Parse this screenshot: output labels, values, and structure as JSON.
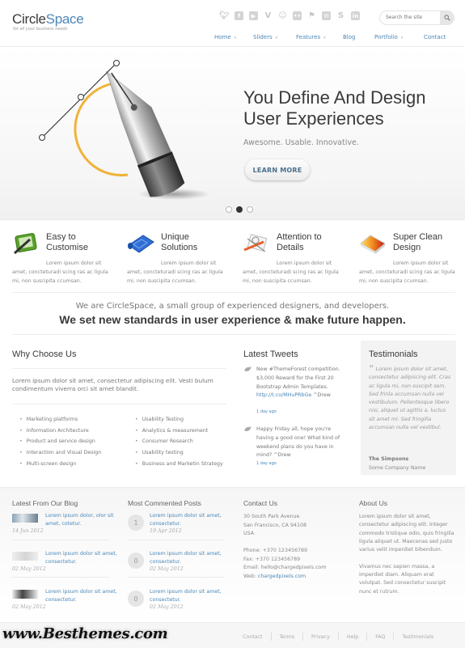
{
  "header": {
    "logo_part1": "Circle",
    "logo_part2": "Space",
    "tagline": "for all your business needs",
    "social_icons": [
      "twitter-icon",
      "facebook-icon",
      "youtube-icon",
      "vimeo-icon",
      "stumbleupon-icon",
      "flickr-icon",
      "delicious-icon",
      "email-icon",
      "skype-icon",
      "linkedin-icon"
    ],
    "search_placeholder": "Search the site"
  },
  "nav": [
    {
      "label": "Home",
      "has_dropdown": true
    },
    {
      "label": "Sliders",
      "has_dropdown": true
    },
    {
      "label": "Features",
      "has_dropdown": true
    },
    {
      "label": "Blog",
      "has_dropdown": false
    },
    {
      "label": "Portfolio",
      "has_dropdown": true
    },
    {
      "label": "Contact",
      "has_dropdown": false
    }
  ],
  "hero": {
    "title_line1": "You Define And Design",
    "title_line2": "User Experiences",
    "subtitle": "Awesome. Usable. Innovative.",
    "button_label": "LEARN MORE",
    "slides_count": 3,
    "active_slide": 2
  },
  "features": [
    {
      "title_line1": "Easy to",
      "title_line2": "Customise",
      "text": "Lorem ipsum dolor sit amet, concteturadi scing ras ac ligula mi, non suscipita ccumsan."
    },
    {
      "title_line1": "Unique",
      "title_line2": "Solutions",
      "text": "Lorem ipsum dolor sit amet, concteturadi scing ras ac ligula mi, non suscipita ccumsan."
    },
    {
      "title_line1": "Attention to",
      "title_line2": "Details",
      "text": "Lorem ipsum dolor sit amet, concteturadi scing ras ac ligula mi, non suscipita ccumsan."
    },
    {
      "title_line1": "Super Clean",
      "title_line2": "Design",
      "text": "Lorem ipsum dolor sit amet, concteturadi scing ras ac ligula mi, non suscipita ccumsan."
    }
  ],
  "intro": {
    "line1": "We are CircleSpace, a small group of experienced designers, and developers.",
    "line2": "We set new standards in user experience & make future happen."
  },
  "why": {
    "title": "Why Choose Us",
    "text": "Lorem ipsum dolor sit amet, consectetur adipiscing elit. Vesti bulum condimentum viverra orci sit amet blandit.",
    "list_left": [
      "Marketing platforms",
      "Information Architecture",
      "Product and service design",
      "Interaction and Visual Design",
      "Multi-screen design"
    ],
    "list_right": [
      "Usability Testing",
      "Analytics & measurement",
      "Consumer Research",
      "Usability testing",
      "Business and Marketin Strategy"
    ]
  },
  "tweets": {
    "title": "Latest Tweets",
    "items": [
      {
        "text": "New #ThemeForest competition. $3,000 Reward for the First 20 Bootstrap Admin Templates. ",
        "link": "http://t.co/MHuPRbGe",
        "suffix": " ^Drew",
        "date": "1 day ago"
      },
      {
        "text": "Happy Friday all, hope you're having a good one! What kind of weekend plans do you have in mind? ^Drew",
        "link": "",
        "suffix": "",
        "date": "1 day ago"
      }
    ]
  },
  "testimonials": {
    "title": "Testimonials",
    "quote": "Lorem ipsum dolor sit amet, consectetur adipiscing elit. Cras ac ligula mi, non suscipit sem. Sed frinla accumsan nulla vel vestibulum. Pellentesque libero nisi, aliquet ut agittis a, luctus sit amet mi. Sed fringilla accumsan nulla vel vestibul.",
    "author": "The Simpsons",
    "company": "Some Company Name"
  },
  "footer": {
    "blog": {
      "title": "Latest From Our Blog",
      "items": [
        {
          "title": "Lorem ipsum dolor, olor sit amet, cotetur.",
          "date": "14 Jun 2012"
        },
        {
          "title": "Lorem ipsum dolor sit amet, consectetur.",
          "date": "02 May 2012"
        },
        {
          "title": "Lorem ipsum dolor sit amet, consectetur.",
          "date": "02 May 2012"
        }
      ]
    },
    "commented": {
      "title": "Most Commented Posts",
      "items": [
        {
          "count": "1",
          "title": "Lorem ipsum dolor sit amet, consectetur.",
          "date": "19 Apr 2012"
        },
        {
          "count": "0",
          "title": "Lorem ipsum dolor sit amet, consectetur.",
          "date": "02 May 2012"
        },
        {
          "count": "0",
          "title": "Lorem ipsum dolor sit amet, consectetur.",
          "date": "02 May 2012"
        }
      ]
    },
    "contact": {
      "title": "Contact Us",
      "address1": "30 South Park Avenue",
      "address2": "San Francisco, CA 94108",
      "address3": "USA",
      "phone": "Phone: +370 123456789",
      "fax": "Fax: +370 123456789",
      "email": "Email: hello@chargedpixels.com",
      "web_label": "Web: ",
      "web_link": "chargedpixels.com"
    },
    "about": {
      "title": "About Us",
      "para1": "Lorem ipsum dolor sit amet, consectetur adipiscing elit. Integer commodo tristique odio, quis fringilla ligula aliquet ut. Maecenas sed justo varius velit imperdiet bibendum.",
      "para2": "Vivamus nec sapien massa, a imperdiet diam. Aliquam erat volutpat. Sed consectetur suscipit nunc et rutrum."
    },
    "watermark": "www.Besthemes.com",
    "links": [
      "Contact",
      "Terms",
      "Privacy",
      "Help",
      "FAQ",
      "Testimonials"
    ]
  }
}
